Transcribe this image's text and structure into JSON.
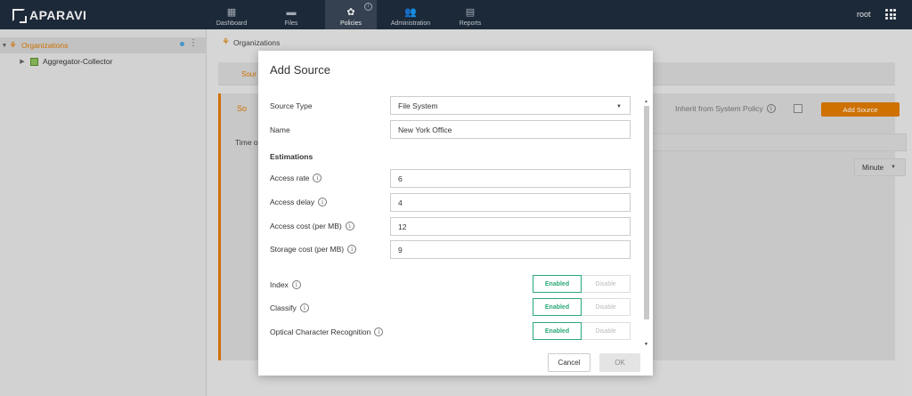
{
  "app": {
    "logo_text": "APARAVI",
    "user": "root"
  },
  "nav": [
    {
      "label": "Dashboard",
      "icon": "▦"
    },
    {
      "label": "Files",
      "icon": "▬"
    },
    {
      "label": "Policies",
      "icon": "✿"
    },
    {
      "label": "Administration",
      "icon": "👥"
    },
    {
      "label": "Reports",
      "icon": "▤"
    }
  ],
  "sidebar": {
    "items": [
      {
        "label": "Organizations"
      },
      {
        "label": "Aggregator-Collector"
      }
    ]
  },
  "main": {
    "breadcrumb": "Organizations",
    "tab_label": "Sour",
    "panel_label": "So",
    "inherit_label": "Inherit from System Policy",
    "add_source_label": "Add Source",
    "time_label": "Time o",
    "minute_label": "Minute"
  },
  "modal": {
    "title": "Add Source",
    "source_type": {
      "label": "Source Type",
      "value": "File System"
    },
    "name": {
      "label": "Name",
      "value": "New York Office"
    },
    "estimations_label": "Estimations",
    "access_rate": {
      "label": "Access rate",
      "value": "6"
    },
    "access_delay": {
      "label": "Access delay",
      "value": "4"
    },
    "access_cost": {
      "label": "Access cost (per MB)",
      "value": "12"
    },
    "storage_cost": {
      "label": "Storage cost (per MB)",
      "value": "9"
    },
    "index": {
      "label": "Index",
      "on": "Enabled",
      "off": "Disable"
    },
    "classify": {
      "label": "Classify",
      "on": "Enabled",
      "off": "Disable"
    },
    "ocr": {
      "label": "Optical Character Recognition",
      "on": "Enabled",
      "off": "Disable"
    },
    "cancel_label": "Cancel",
    "ok_label": "OK"
  },
  "colors": {
    "accent": "#e07b00",
    "toggle_on": "#2aa876",
    "topbar": "#1f2d3d"
  }
}
